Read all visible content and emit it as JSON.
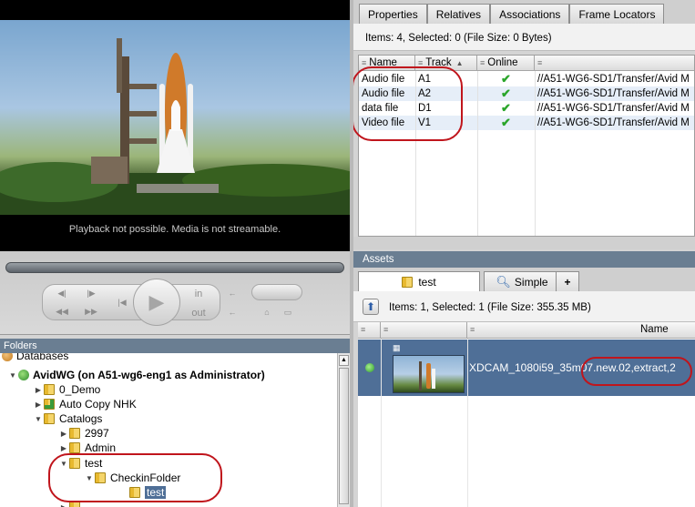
{
  "player": {
    "message": "Playback not possible. Media is not streamable.",
    "controls": {
      "in_label": "in",
      "out_label": "out"
    }
  },
  "folders": {
    "header": "Folders",
    "items": [
      {
        "label": "Databases",
        "level": 0,
        "icon": "database-icon"
      },
      {
        "label": "AvidWG (on A51-wg6-eng1 as Administrator)",
        "level": 1,
        "icon": "server-icon",
        "expanded": true
      },
      {
        "label": "0_Demo",
        "level": 2,
        "icon": "folder-icon"
      },
      {
        "label": "Auto Copy NHK",
        "level": 2,
        "icon": "auto-folder-icon"
      },
      {
        "label": "Catalogs",
        "level": 2,
        "icon": "folder-icon",
        "expanded": true
      },
      {
        "label": "2997",
        "level": 3,
        "icon": "folder-icon"
      },
      {
        "label": "Admin",
        "level": 3,
        "icon": "folder-icon"
      },
      {
        "label": "test",
        "level": 3,
        "icon": "folder-icon",
        "expanded": true
      },
      {
        "label": "CheckinFolder",
        "level": 4,
        "icon": "folder-icon",
        "expanded": true
      },
      {
        "label": "test",
        "level": 5,
        "icon": "folder-icon",
        "selected": true
      }
    ]
  },
  "properties": {
    "tabs": [
      "Properties",
      "Relatives",
      "Associations",
      "Frame Locators"
    ],
    "status": "Items: 4, Selected: 0 (File Size: 0 Bytes)",
    "columns": [
      "Name",
      "Track",
      "Online",
      ""
    ],
    "rows": [
      {
        "name": "Audio file",
        "track": "A1",
        "online": true,
        "path": "//A51-WG6-SD1/Transfer/Avid M"
      },
      {
        "name": "Audio file",
        "track": "A2",
        "online": true,
        "path": "//A51-WG6-SD1/Transfer/Avid M"
      },
      {
        "name": "data file",
        "track": "D1",
        "online": true,
        "path": "//A51-WG6-SD1/Transfer/Avid M"
      },
      {
        "name": "Video file",
        "track": "V1",
        "online": true,
        "path": "//A51-WG6-SD1/Transfer/Avid M"
      }
    ]
  },
  "assets": {
    "header": "Assets",
    "tabs": [
      {
        "label": "test",
        "icon": "folder-icon"
      },
      {
        "label": "Simple",
        "icon": "search-icon"
      },
      {
        "label": "+",
        "icon": ""
      }
    ],
    "status": "Items: 1, Selected: 1 (File Size: 355.35 MB)",
    "columns": [
      "",
      "",
      "Name"
    ],
    "row": {
      "name_part1": "XDCAM_1080i59_35m",
      "name_part2": "07.new.02,extract,2"
    }
  },
  "colors": {
    "selection": "#4f6f97",
    "header_bar": "#6a7e92",
    "online_check": "#2aa52a",
    "annotation": "#c0151c"
  }
}
